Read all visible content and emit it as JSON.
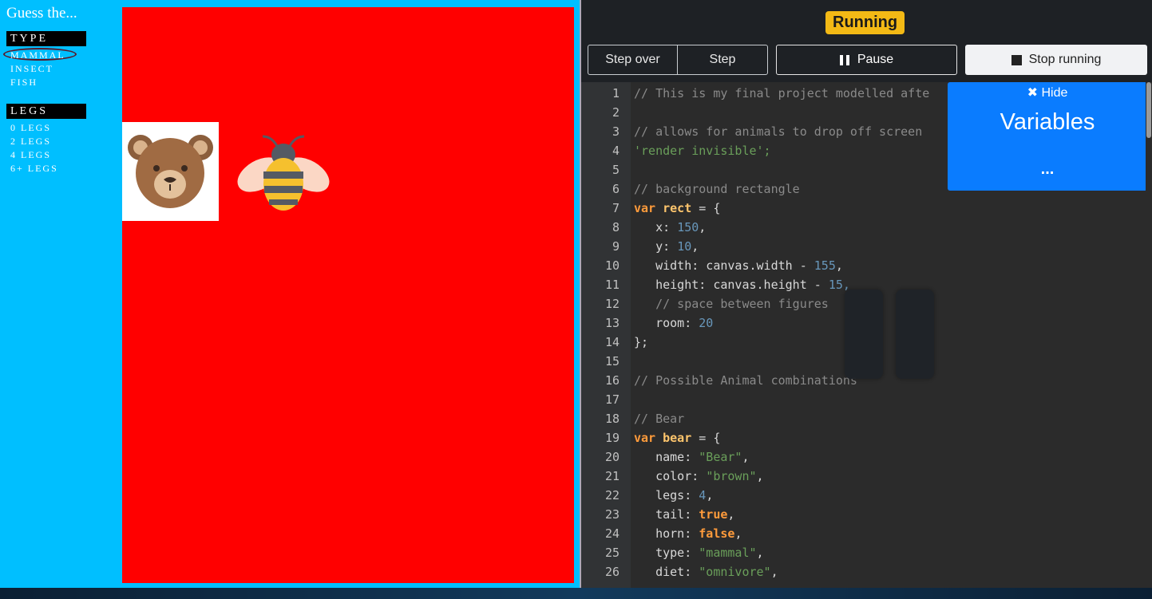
{
  "game": {
    "title": "Guess the...",
    "type_header": "TYPE",
    "type_options": [
      "MAMMAL",
      "INSECT",
      "FISH"
    ],
    "legs_header": "LEGS",
    "legs_options": [
      "0 LEGS",
      "2 LEGS",
      "4 LEGS",
      "6+ LEGS"
    ],
    "stage_color": "#ff0000",
    "background_color": "#00bfff",
    "figures": [
      "bear-icon",
      "bee-icon"
    ]
  },
  "toolbar": {
    "status": "Running",
    "step_over": "Step over",
    "step": "Step",
    "pause": "Pause",
    "stop": "Stop running"
  },
  "variables_panel": {
    "hide_label": "✖ Hide",
    "title": "Variables",
    "ellipsis": "..."
  },
  "code_lines": [
    "1",
    "2",
    "3",
    "4",
    "5",
    "6",
    "7",
    "8",
    "9",
    "10",
    "11",
    "12",
    "13",
    "14",
    "15",
    "16",
    "17",
    "18",
    "19",
    "20",
    "21",
    "22",
    "23",
    "24",
    "25",
    "26"
  ],
  "code": {
    "l1": "// This is my final project modelled afte",
    "l3": "// allows for animals to drop off screen",
    "l4": "'render invisible';",
    "l6": "// background rectangle",
    "l7_kw": "var",
    "l7_name": "rect",
    "l7_rest": " = {",
    "l8_key": "   x: ",
    "l8_val": "150",
    "l9_key": "   y: ",
    "l9_val": "10",
    "l10_key": "   width: canvas.width - ",
    "l10_val": "155",
    "l11_key": "   height: canvas.height - ",
    "l11_val": "15,",
    "l12": "   // space between figures",
    "l13_key": "   room: ",
    "l13_val": "20",
    "l14": "};",
    "l16": "// Possible Animal combinations",
    "l18": "// Bear",
    "l19_kw": "var",
    "l19_name": "bear",
    "l19_rest": " = {",
    "l20_key": "   name: ",
    "l20_val": "\"Bear\"",
    "l21_key": "   color: ",
    "l21_val": "\"brown\"",
    "l22_key": "   legs: ",
    "l22_val": "4",
    "l23_key": "   tail: ",
    "l23_val": "true",
    "l24_key": "   horn: ",
    "l24_val": "false",
    "l25_key": "   type: ",
    "l25_val": "\"mammal\"",
    "l26_key": "   diet: ",
    "l26_val": "\"omnivore\""
  }
}
